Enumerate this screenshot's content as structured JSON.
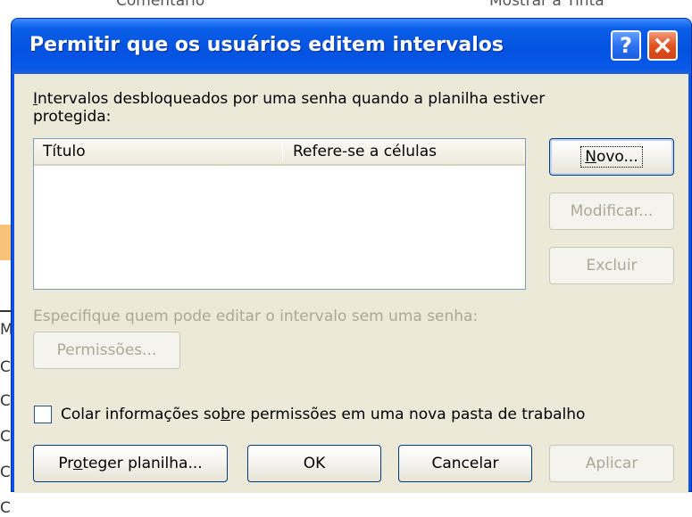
{
  "background": {
    "top_left_text": "Comentário",
    "top_right_text": "Mostrar a Tinta",
    "left_glyphs": [
      "M",
      "C",
      "C",
      "C",
      "C",
      "C"
    ]
  },
  "dialog": {
    "title": "Permitir que os usuários editem intervalos",
    "help_glyph": "?",
    "close_icon": "close-x-icon"
  },
  "ranges": {
    "label_accel": "I",
    "label_rest_line1": "ntervalos desbloqueados por uma senha quando a planilha estiver",
    "label_line2": "protegida:",
    "columns": [
      "Título",
      "Refere-se a células"
    ],
    "rows": []
  },
  "buttons": {
    "new_accel": "N",
    "new_rest": "ovo...",
    "modify": "Modificar...",
    "delete": "Excluir",
    "permissions": "Permissões...",
    "protect_pre": "Pr",
    "protect_accel": "o",
    "protect_post": "teger planilha...",
    "ok": "OK",
    "cancel": "Cancelar",
    "apply": "Aplicar"
  },
  "specify": {
    "label": "Especifique quem pode editar o intervalo sem uma senha:"
  },
  "paste_option": {
    "pre": "Colar informações so",
    "accel": "b",
    "post": "re permissões em uma nova pasta de trabalho",
    "checked": false
  },
  "colors": {
    "title_bar": "#0a58e8",
    "client": "#ece9d8",
    "disabled_text": "#aca899"
  }
}
